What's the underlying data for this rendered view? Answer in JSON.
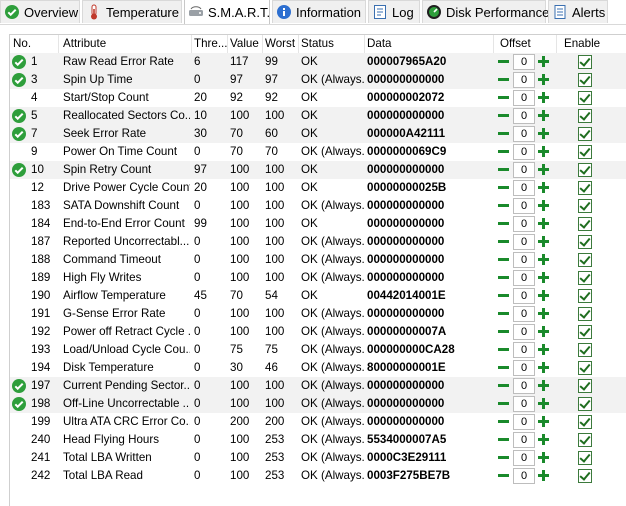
{
  "tabs": [
    {
      "label": "Overview",
      "icon": "check-circle-icon",
      "active": false
    },
    {
      "label": "Temperature",
      "icon": "thermometer-icon",
      "active": false
    },
    {
      "label": "S.M.A.R.T.",
      "icon": "hard-drive-icon",
      "active": true
    },
    {
      "label": "Information",
      "icon": "info-icon",
      "active": false
    },
    {
      "label": "Log",
      "icon": "log-icon",
      "active": false
    },
    {
      "label": "Disk Performance",
      "icon": "gauge-icon",
      "active": false
    },
    {
      "label": "Alerts",
      "icon": "alert-icon",
      "active": false
    }
  ],
  "table": {
    "headers": {
      "no": "No.",
      "attribute": "Attribute",
      "threshold": "Thre...",
      "value": "Value",
      "worst": "Worst",
      "status": "Status",
      "data": "Data",
      "offset": "Offset",
      "enable": "Enable"
    },
    "rows": [
      {
        "ok": true,
        "no": "1",
        "attribute": "Raw Read Error Rate",
        "threshold": "6",
        "value": "117",
        "worst": "99",
        "status": "OK",
        "data": "000007965A20",
        "offset": "0",
        "enabled": true
      },
      {
        "ok": true,
        "no": "3",
        "attribute": "Spin Up Time",
        "threshold": "0",
        "value": "97",
        "worst": "97",
        "status": "OK (Always...",
        "data": "000000000000",
        "offset": "0",
        "enabled": true
      },
      {
        "ok": false,
        "no": "4",
        "attribute": "Start/Stop Count",
        "threshold": "20",
        "value": "92",
        "worst": "92",
        "status": "OK",
        "data": "000000002072",
        "offset": "0",
        "enabled": true
      },
      {
        "ok": true,
        "no": "5",
        "attribute": "Reallocated Sectors Co...",
        "threshold": "10",
        "value": "100",
        "worst": "100",
        "status": "OK",
        "data": "000000000000",
        "offset": "0",
        "enabled": true
      },
      {
        "ok": true,
        "no": "7",
        "attribute": "Seek Error Rate",
        "threshold": "30",
        "value": "70",
        "worst": "60",
        "status": "OK",
        "data": "000000A42111",
        "offset": "0",
        "enabled": true
      },
      {
        "ok": false,
        "no": "9",
        "attribute": "Power On Time Count",
        "threshold": "0",
        "value": "70",
        "worst": "70",
        "status": "OK (Always...",
        "data": "0000000069C9",
        "offset": "0",
        "enabled": true
      },
      {
        "ok": true,
        "no": "10",
        "attribute": "Spin Retry Count",
        "threshold": "97",
        "value": "100",
        "worst": "100",
        "status": "OK",
        "data": "000000000000",
        "offset": "0",
        "enabled": true
      },
      {
        "ok": false,
        "no": "12",
        "attribute": "Drive Power Cycle Count",
        "threshold": "20",
        "value": "100",
        "worst": "100",
        "status": "OK",
        "data": "00000000025B",
        "offset": "0",
        "enabled": true
      },
      {
        "ok": false,
        "no": "183",
        "attribute": "SATA Downshift Count",
        "threshold": "0",
        "value": "100",
        "worst": "100",
        "status": "OK (Always...",
        "data": "000000000000",
        "offset": "0",
        "enabled": true
      },
      {
        "ok": false,
        "no": "184",
        "attribute": "End-to-End Error Count",
        "threshold": "99",
        "value": "100",
        "worst": "100",
        "status": "OK",
        "data": "000000000000",
        "offset": "0",
        "enabled": true
      },
      {
        "ok": false,
        "no": "187",
        "attribute": "Reported Uncorrectabl...",
        "threshold": "0",
        "value": "100",
        "worst": "100",
        "status": "OK (Always...",
        "data": "000000000000",
        "offset": "0",
        "enabled": true
      },
      {
        "ok": false,
        "no": "188",
        "attribute": "Command Timeout",
        "threshold": "0",
        "value": "100",
        "worst": "100",
        "status": "OK (Always...",
        "data": "000000000000",
        "offset": "0",
        "enabled": true
      },
      {
        "ok": false,
        "no": "189",
        "attribute": "High Fly Writes",
        "threshold": "0",
        "value": "100",
        "worst": "100",
        "status": "OK (Always...",
        "data": "000000000000",
        "offset": "0",
        "enabled": true
      },
      {
        "ok": false,
        "no": "190",
        "attribute": "Airflow Temperature",
        "threshold": "45",
        "value": "70",
        "worst": "54",
        "status": "OK",
        "data": "00442014001E",
        "offset": "0",
        "enabled": true
      },
      {
        "ok": false,
        "no": "191",
        "attribute": "G-Sense Error Rate",
        "threshold": "0",
        "value": "100",
        "worst": "100",
        "status": "OK (Always...",
        "data": "000000000000",
        "offset": "0",
        "enabled": true
      },
      {
        "ok": false,
        "no": "192",
        "attribute": "Power off Retract Cycle ...",
        "threshold": "0",
        "value": "100",
        "worst": "100",
        "status": "OK (Always...",
        "data": "00000000007A",
        "offset": "0",
        "enabled": true
      },
      {
        "ok": false,
        "no": "193",
        "attribute": "Load/Unload Cycle Cou...",
        "threshold": "0",
        "value": "75",
        "worst": "75",
        "status": "OK (Always...",
        "data": "000000000CA28",
        "offset": "0",
        "enabled": true
      },
      {
        "ok": false,
        "no": "194",
        "attribute": "Disk Temperature",
        "threshold": "0",
        "value": "30",
        "worst": "46",
        "status": "OK (Always...",
        "data": "80000000001E",
        "offset": "0",
        "enabled": true
      },
      {
        "ok": true,
        "no": "197",
        "attribute": "Current Pending Sector...",
        "threshold": "0",
        "value": "100",
        "worst": "100",
        "status": "OK (Always...",
        "data": "000000000000",
        "offset": "0",
        "enabled": true
      },
      {
        "ok": true,
        "no": "198",
        "attribute": "Off-Line Uncorrectable ...",
        "threshold": "0",
        "value": "100",
        "worst": "100",
        "status": "OK (Always...",
        "data": "000000000000",
        "offset": "0",
        "enabled": true
      },
      {
        "ok": false,
        "no": "199",
        "attribute": "Ultra ATA CRC Error Co...",
        "threshold": "0",
        "value": "200",
        "worst": "200",
        "status": "OK (Always...",
        "data": "000000000000",
        "offset": "0",
        "enabled": true
      },
      {
        "ok": false,
        "no": "240",
        "attribute": "Head Flying Hours",
        "threshold": "0",
        "value": "100",
        "worst": "253",
        "status": "OK (Always...",
        "data": "5534000007A5",
        "offset": "0",
        "enabled": true
      },
      {
        "ok": false,
        "no": "241",
        "attribute": "Total LBA Written",
        "threshold": "0",
        "value": "100",
        "worst": "253",
        "status": "OK (Always...",
        "data": "0000C3E29111",
        "offset": "0",
        "enabled": true
      },
      {
        "ok": false,
        "no": "242",
        "attribute": "Total LBA Read",
        "threshold": "0",
        "value": "100",
        "worst": "253",
        "status": "OK (Always...",
        "data": "0003F275BE7B",
        "offset": "0",
        "enabled": true
      }
    ]
  },
  "colors": {
    "ok_green": "#2e9e3b",
    "accent_green": "#1a8a2b",
    "alt_row": "#f2f2f2"
  }
}
